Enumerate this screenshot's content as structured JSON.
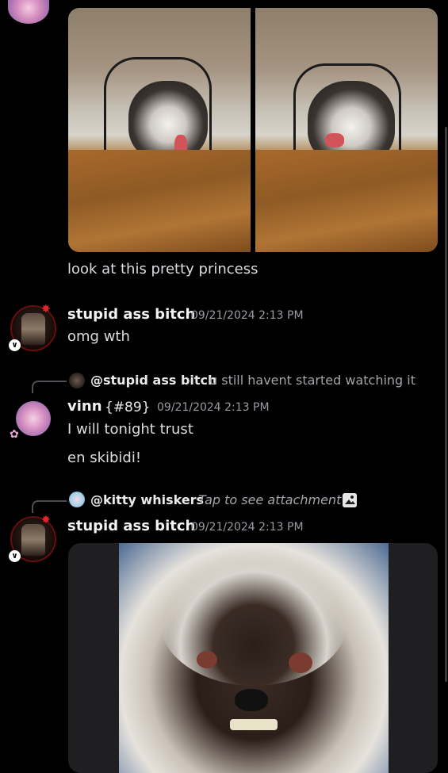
{
  "caption_message": {
    "text": "look at this pretty princess"
  },
  "messages": [
    {
      "author": "stupid ass bitch",
      "timestamp": "09/21/2024 2:13 PM",
      "lines": [
        "omg wth"
      ]
    },
    {
      "reply_to": {
        "author": "@stupid ass bitch",
        "preview": "u still havent started watching it"
      },
      "author": "vinn",
      "tag": "{#89}",
      "timestamp": "09/21/2024 2:13 PM",
      "lines": [
        "I will tonight trust",
        "en skibidi!"
      ]
    },
    {
      "reply_to": {
        "author": "@kitty whiskers",
        "preview": "Tap to see attachment"
      },
      "author": "stupid ass bitch",
      "timestamp": "09/21/2024 2:13 PM",
      "lines": []
    }
  ],
  "badges": {
    "avatar_badge": "∨"
  },
  "colors": {
    "background": "#000000",
    "text": "#dcdde1",
    "timestamp": "#9a9ca3",
    "reply_preview": "#a3a5ab"
  }
}
